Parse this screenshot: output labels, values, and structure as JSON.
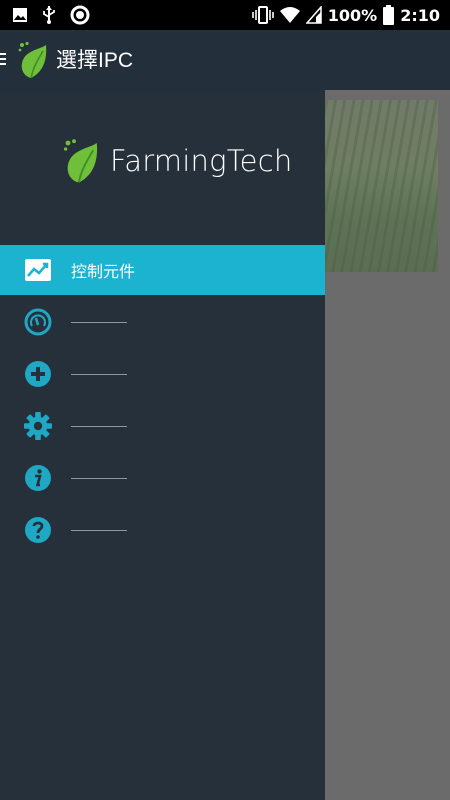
{
  "status_bar": {
    "battery": "100%",
    "time": "2:10",
    "icons": [
      "image-icon",
      "usb-icon",
      "record-icon",
      "vibrate-icon",
      "wifi-icon",
      "signal-icon",
      "battery-icon"
    ]
  },
  "app_bar": {
    "title": "選擇IPC",
    "menu_icon": "hamburger-menu-icon",
    "logo_icon": "leaf-logo-icon"
  },
  "drawer": {
    "brand": "FarmingTech",
    "items": [
      {
        "icon": "trending-chart-icon",
        "label": "控制元件",
        "active": true
      },
      {
        "icon": "gauge-icon",
        "label": "",
        "active": false
      },
      {
        "icon": "add-circle-icon",
        "label": "",
        "active": false
      },
      {
        "icon": "gear-icon",
        "label": "",
        "active": false
      },
      {
        "icon": "info-icon",
        "label": "",
        "active": false
      },
      {
        "icon": "help-icon",
        "label": "",
        "active": false
      }
    ]
  },
  "colors": {
    "status_bar": "#000000",
    "app_bar": "#232f3a",
    "drawer": "#26303b",
    "accent": "#1bb3d0",
    "scrim": "#6b6b6b",
    "leaf_green": "#6fbf3a"
  }
}
